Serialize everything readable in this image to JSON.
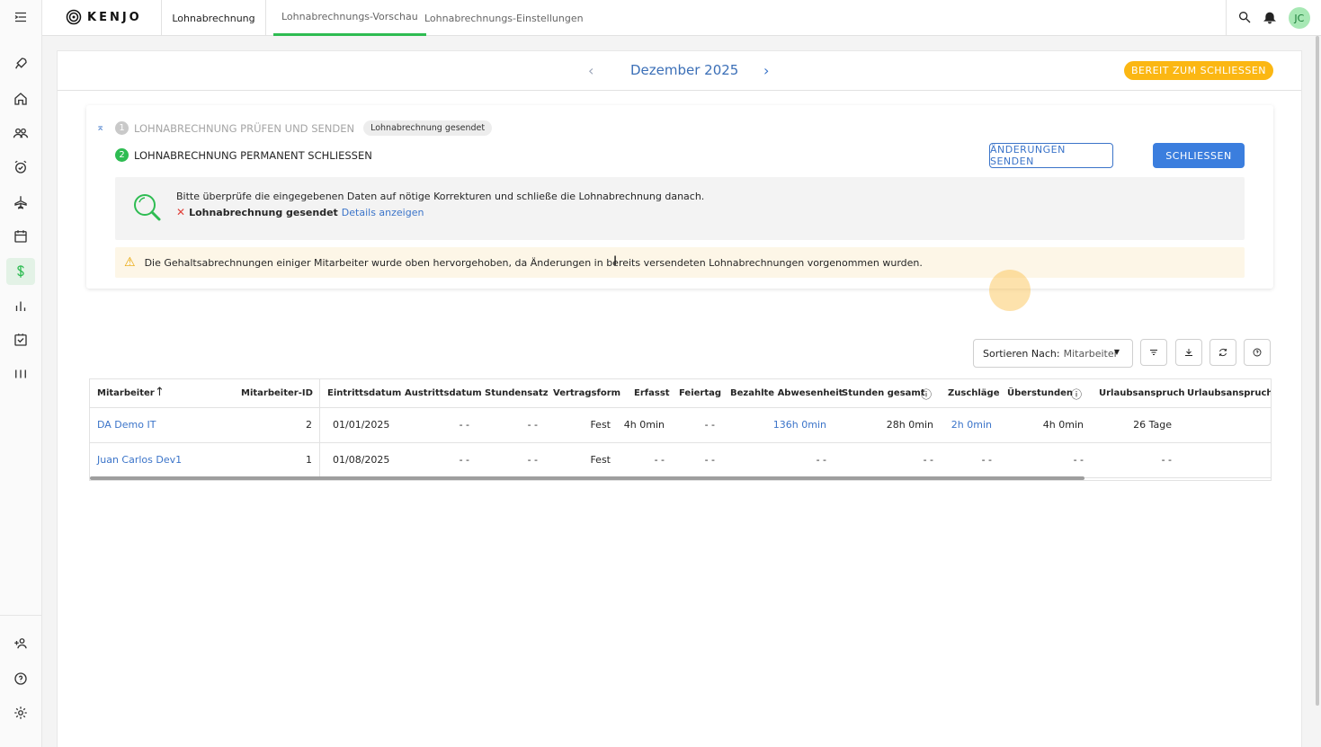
{
  "app": {
    "logo_text": "KENJO",
    "tabs": [
      {
        "label": "Lohnabrechnung"
      },
      {
        "label": "Lohnabrechnungs-Vorschau"
      },
      {
        "label": "Lohnabrechnungs-Einstellungen"
      }
    ],
    "active_tab": "Lohnabrechnungs-Vorschau",
    "user_initials": "JC",
    "accent_color": "#2ebc52",
    "link_color": "#3b74c9"
  },
  "sidebar": {
    "items": [
      {
        "icon": "menu-toggle-icon"
      },
      {
        "icon": "rocket-icon"
      },
      {
        "icon": "home-icon"
      },
      {
        "icon": "people-icon"
      },
      {
        "icon": "alarm-clock-icon"
      },
      {
        "icon": "airplane-icon"
      },
      {
        "icon": "calendar-icon"
      },
      {
        "icon": "dollar-icon",
        "active": true
      },
      {
        "icon": "bar-chart-icon"
      },
      {
        "icon": "task-check-icon"
      },
      {
        "icon": "columns-icon"
      }
    ],
    "bottom_items": [
      {
        "icon": "add-person-icon"
      },
      {
        "icon": "help-icon"
      },
      {
        "icon": "settings-gear-icon"
      }
    ]
  },
  "period": {
    "label": "Dezember 2025",
    "status": "BEREIT ZUM SCHLIESSEN",
    "status_color": "#fbb713"
  },
  "steps": {
    "step1": {
      "number": "1",
      "label": "LOHNABRECHNUNG PRÜFEN UND SENDEN",
      "chip": "Lohnabrechnung gesendet"
    },
    "step2": {
      "number": "2",
      "label": "LOHNABRECHNUNG PERMANENT SCHLIESSEN"
    },
    "send_changes_label": "ÄNDERUNGEN SENDEN",
    "close_label": "SCHLIESSEN",
    "info_text": "Bitte überprüfe die eingegebenen Daten auf nötige Korrekturen und schließe die Lohnabrechnung danach.",
    "info_status": "Lohnabrechnung gesendet",
    "info_link": "Details anzeigen",
    "warning_text": "Die Gehaltsabrechnungen einiger Mitarbeiter wurde oben hervorgehoben, da Änderungen in bereits versendeten Lohnabrechnungen vorgenommen wurden."
  },
  "toolbar": {
    "sort_prefix": "Sortieren Nach:",
    "sort_value": "Mitarbeiter"
  },
  "table": {
    "columns": [
      "Mitarbeiter",
      "Mitarbeiter-ID",
      "Eintrittsdatum",
      "Austrittsdatum",
      "Stundensatz",
      "Vertragsform",
      "Erfasst",
      "Feiertag",
      "Bezahlte Abwesenheit",
      "Stunden gesamt",
      "Zuschläge",
      "Überstunden",
      "Urlaubsanspruch",
      "Urlaubsanspruch au"
    ],
    "rows": [
      [
        "DA Demo IT",
        "2",
        "01/01/2025",
        "- -",
        "- -",
        "Fest",
        "4h 0min",
        "- -",
        "136h 0min",
        "28h 0min",
        "2h 0min",
        "4h 0min",
        "26 Tage"
      ],
      [
        "Juan Carlos Dev1",
        "1",
        "01/08/2025",
        "- -",
        "- -",
        "Fest",
        "- -",
        "- -",
        "- -",
        "- -",
        "- -",
        "- -",
        "- -"
      ]
    ]
  }
}
